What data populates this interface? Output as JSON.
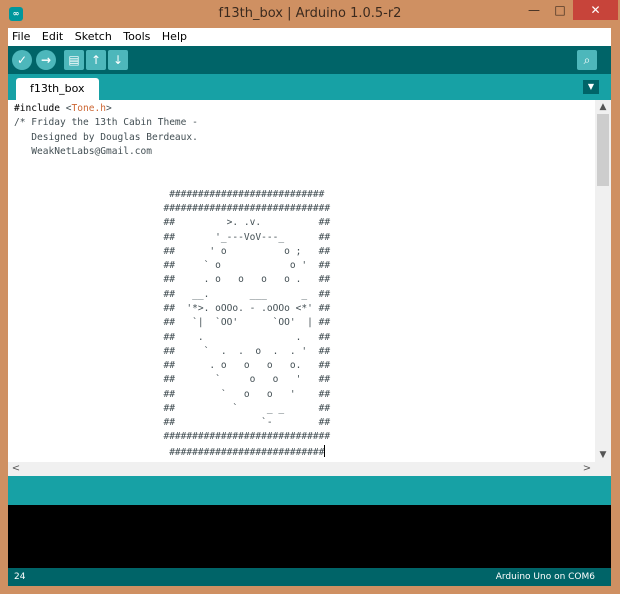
{
  "window": {
    "title": "f13th_box | Arduino 1.0.5-r2",
    "app_icon": "arduino-infinity-icon",
    "buttons": {
      "minimize": "—",
      "maximize": "□",
      "close": "✕"
    }
  },
  "menu": [
    "File",
    "Edit",
    "Sketch",
    "Tools",
    "Help"
  ],
  "toolbar": {
    "verify": "✓",
    "upload": "→",
    "new": "▤",
    "open": "↑",
    "save": "↓",
    "serial_monitor": "⌕"
  },
  "tab": {
    "label": "f13th_box",
    "menu_arrow": "▼"
  },
  "code": {
    "include_kw": "#include",
    "include_open": " <",
    "include_lib": "Tone.h",
    "include_close": ">",
    "body": "/* Friday the 13th Cabin Theme -\n   Designed by Douglas Berdeaux.\n   WeakNetLabs@Gmail.com\n\n\n                           ###########################\n                          #############################\n                          ##         >. .v.          ##\n                          ##       '_---VoV---_      ##\n                          ##      ' o          o ;   ##\n                          ##     ` o            o '  ##\n                          ##     . o   o   o   o .   ##\n                          ##   __.       ___      _  ##\n                          ##  '*>. oOOo. - .oOOo <*' ##\n                          ##   `|  `OO'      `OO'  | ##\n                          ##    .                .   ##\n                          ##     `  .  .  o  .  . '  ##\n                          ##      . o   o   o   o.   ##\n                          ##       `     o   o   '   ##\n                          ##        `   o   o   '    ##\n                          ##          `     _ _      ##\n                          ##               `-        ##\n                          #############################\n                           ###########################",
    "after": "\n\n                            */"
  },
  "scroll": {
    "up": "▲",
    "down": "▼",
    "left": "<",
    "right": ">"
  },
  "footer": {
    "line": "24",
    "board": "Arduino Uno on COM6"
  },
  "colors": {
    "teal_dark": "#006468",
    "teal": "#17a1a5",
    "accent": "#4db7bb"
  }
}
